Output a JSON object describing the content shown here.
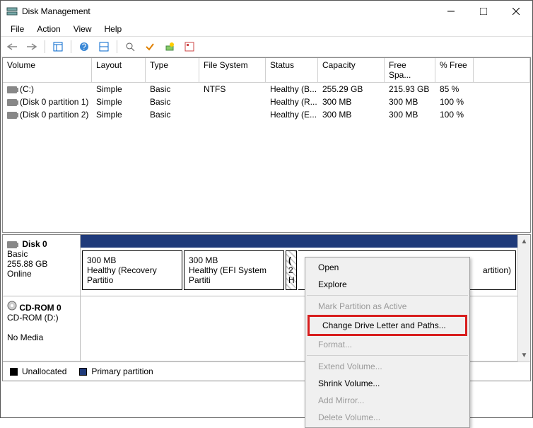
{
  "window": {
    "title": "Disk Management"
  },
  "menu": [
    "File",
    "Action",
    "View",
    "Help"
  ],
  "columns": [
    "Volume",
    "Layout",
    "Type",
    "File System",
    "Status",
    "Capacity",
    "Free Spa...",
    "% Free"
  ],
  "volumes": [
    {
      "name": "(C:)",
      "layout": "Simple",
      "type": "Basic",
      "fs": "NTFS",
      "status": "Healthy (B...",
      "capacity": "255.29 GB",
      "free": "215.93 GB",
      "pct": "85 %"
    },
    {
      "name": "(Disk 0 partition 1)",
      "layout": "Simple",
      "type": "Basic",
      "fs": "",
      "status": "Healthy (R...",
      "capacity": "300 MB",
      "free": "300 MB",
      "pct": "100 %"
    },
    {
      "name": "(Disk 0 partition 2)",
      "layout": "Simple",
      "type": "Basic",
      "fs": "",
      "status": "Healthy (E...",
      "capacity": "300 MB",
      "free": "300 MB",
      "pct": "100 %"
    }
  ],
  "disk0": {
    "name": "Disk 0",
    "kind": "Basic",
    "size": "255.88 GB",
    "state": "Online",
    "parts": [
      {
        "size": "300 MB",
        "desc": "Healthy (Recovery Partitio"
      },
      {
        "size": "300 MB",
        "desc": "Healthy (EFI System Partiti"
      },
      {
        "size": "(",
        "desc": "2\nH"
      },
      {
        "size": "",
        "desc": "artition)"
      }
    ]
  },
  "cdrom": {
    "name": "CD-ROM 0",
    "sub": "CD-ROM (D:)",
    "state": "No Media"
  },
  "legend": {
    "unalloc": "Unallocated",
    "primary": "Primary partition"
  },
  "context": {
    "open": "Open",
    "explore": "Explore",
    "mark": "Mark Partition as Active",
    "change": "Change Drive Letter and Paths...",
    "format": "Format...",
    "extend": "Extend Volume...",
    "shrink": "Shrink Volume...",
    "mirror": "Add Mirror...",
    "delete": "Delete Volume..."
  }
}
